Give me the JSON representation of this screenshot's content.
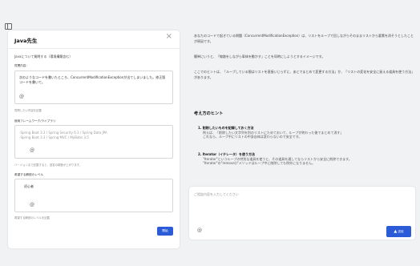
{
  "panel": {
    "title": "Java先生",
    "subtitle": "Javaについて質問する（環境構築含む）",
    "question": {
      "label": "質問内容：",
      "value": "次のようなコードを書いたところ、ConcurrentModificationExceptionが出てしまいました。修正版コードを書いて。",
      "helper": "質問したい内容を記載"
    },
    "framework": {
      "label": "使用フレームワーク/ライブラリ",
      "placeholder_line1": "-Spring Boot 3.3 / Spring Security 6.3 / Spring Data JPA",
      "placeholder_line2": "-Spring Boot 3.3 / Spring MVC / MyBatis 3.5",
      "helper": "バージョンまで記載すると、回答の精度が上がります。"
    },
    "level": {
      "label": "希望する解説のレベル",
      "value": "初心者",
      "helper": "希望する解説のレベルを記載"
    },
    "submit_label": "開始"
  },
  "response": {
    "p1": "あなたのコードで起きている問題（ConcurrentModificationException）は、リストをループで回しながらそのままリストから要素を消そうとしたことが原因です。",
    "p2": "簡単にいうと、「線路をしながら車体を動かす」ことを同時にしようとするイメージです。",
    "p3": "ここでのヒントは、「ループしている間はリストを直接いじらずに、あとでまとめて変更する方法」か、「リストの変化を安全に扱える道具を使う方法」があります。",
    "section_title": "考え方のヒント",
    "items": [
      {
        "title": "1. 削除したいものを記録しておく方法",
        "lines": [
          "例えば、「削除したい文字列を別のリストにためておいて、ループが終わった後でまとめて消す」",
          "これなら、ループ中にリストの中身自体は変わらないので安全です。"
        ]
      },
      {
        "title": "2. Iterator（イテレータ）を使う方法",
        "lines": [
          "\"Iterator\"というループの特別な道具を使うと、その道具を通してならリストから安全に削除できます。",
          "\"Iterator\"の\"remove()\"メソッドはループ中に削除しても例外になりません。"
        ]
      }
    ]
  },
  "chat": {
    "placeholder": "ご相談内容を入力してください",
    "send_label": "送信"
  }
}
